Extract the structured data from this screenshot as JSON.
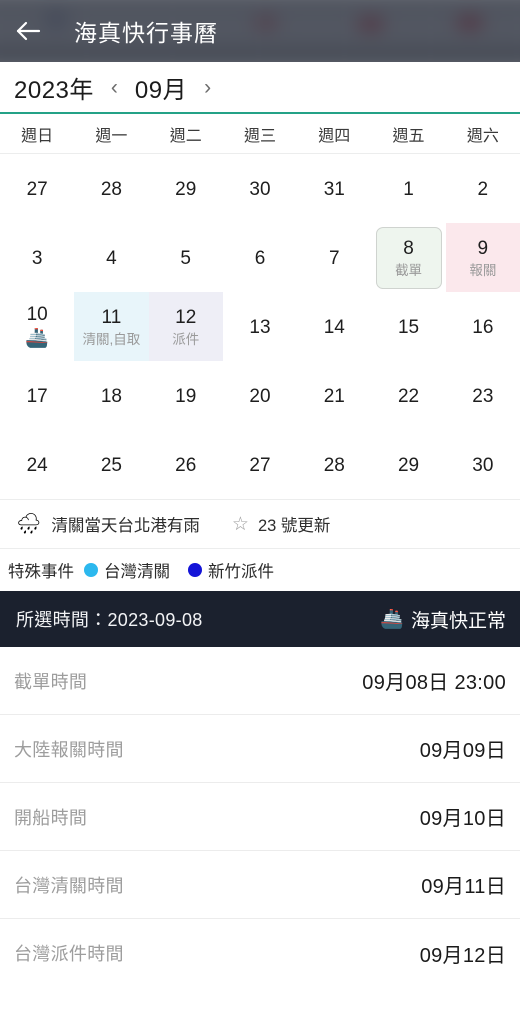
{
  "header": {
    "back_icon": "back-arrow-icon",
    "title": "海真快行事曆"
  },
  "month_nav": {
    "year": "2023年",
    "prev_icon": "‹",
    "month": "09月",
    "next_icon": "›"
  },
  "calendar": {
    "weekdays": [
      "週日",
      "週一",
      "週二",
      "週三",
      "週四",
      "週五",
      "週六"
    ],
    "weeks": [
      [
        {
          "num": "27"
        },
        {
          "num": "28"
        },
        {
          "num": "29"
        },
        {
          "num": "30"
        },
        {
          "num": "31"
        },
        {
          "num": "1"
        },
        {
          "num": "2"
        }
      ],
      [
        {
          "num": "3"
        },
        {
          "num": "4"
        },
        {
          "num": "5"
        },
        {
          "num": "6"
        },
        {
          "num": "7"
        },
        {
          "num": "8",
          "sub": "截單",
          "style": "sel"
        },
        {
          "num": "9",
          "sub": "報關",
          "style": "pink"
        }
      ],
      [
        {
          "num": "10",
          "emoji": "🚢"
        },
        {
          "num": "11",
          "sub": "清關,自取",
          "style": "cyan"
        },
        {
          "num": "12",
          "sub": "派件",
          "style": "lilac"
        },
        {
          "num": "13"
        },
        {
          "num": "14"
        },
        {
          "num": "15"
        },
        {
          "num": "16"
        }
      ],
      [
        {
          "num": "17"
        },
        {
          "num": "18"
        },
        {
          "num": "19"
        },
        {
          "num": "20"
        },
        {
          "num": "21"
        },
        {
          "num": "22"
        },
        {
          "num": "23"
        }
      ],
      [
        {
          "num": "24"
        },
        {
          "num": "25"
        },
        {
          "num": "26"
        },
        {
          "num": "27"
        },
        {
          "num": "28"
        },
        {
          "num": "29"
        },
        {
          "num": "30"
        }
      ]
    ]
  },
  "info_strip": {
    "weather_icon": "🌧",
    "weather_text": "清關當天台北港有雨",
    "star_icon": "☆",
    "update_text": "23 號更新"
  },
  "legend": {
    "title": "特殊事件",
    "items": [
      {
        "label": "台灣清關",
        "color": "#2cb8ee"
      },
      {
        "label": "新竹派件",
        "color": "#1414d8"
      }
    ]
  },
  "selected_bar": {
    "label": "所選時間：2023-09-08",
    "ship_icon": "🚢",
    "status": "海真快正常"
  },
  "details": {
    "rows": [
      {
        "label": "截單時間",
        "value": "09月08日 23:00"
      },
      {
        "label": "大陸報關時間",
        "value": "09月09日"
      },
      {
        "label": "開船時間",
        "value": "09月10日"
      },
      {
        "label": "台灣清關時間",
        "value": "09月11日"
      },
      {
        "label": "台灣派件時間",
        "value": "09月12日"
      }
    ]
  }
}
